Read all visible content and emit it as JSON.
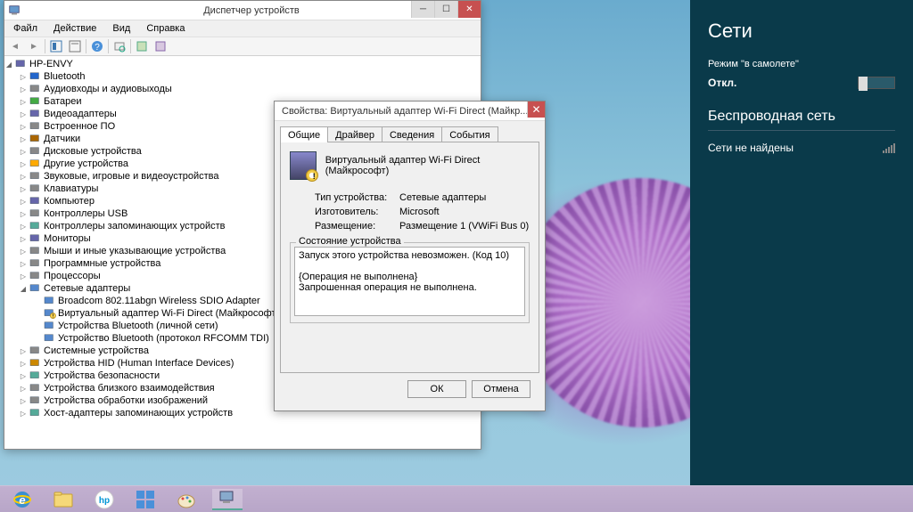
{
  "device_manager": {
    "title": "Диспетчер устройств",
    "menu": [
      "Файл",
      "Действие",
      "Вид",
      "Справка"
    ],
    "root": "HP-ENVY",
    "tree": [
      {
        "label": "Bluetooth",
        "icon": "bt",
        "expand": "▷"
      },
      {
        "label": "Аудиовходы и аудиовыходы",
        "icon": "audio",
        "expand": "▷"
      },
      {
        "label": "Батареи",
        "icon": "battery",
        "expand": "▷"
      },
      {
        "label": "Видеоадаптеры",
        "icon": "display",
        "expand": "▷"
      },
      {
        "label": "Встроенное ПО",
        "icon": "chip",
        "expand": "▷"
      },
      {
        "label": "Датчики",
        "icon": "sensor",
        "expand": "▷"
      },
      {
        "label": "Дисковые устройства",
        "icon": "disk",
        "expand": "▷"
      },
      {
        "label": "Другие устройства",
        "icon": "unknown",
        "expand": "▷"
      },
      {
        "label": "Звуковые, игровые и видеоустройства",
        "icon": "sound",
        "expand": "▷"
      },
      {
        "label": "Клавиатуры",
        "icon": "keyboard",
        "expand": "▷"
      },
      {
        "label": "Компьютер",
        "icon": "computer",
        "expand": "▷"
      },
      {
        "label": "Контроллеры USB",
        "icon": "usb",
        "expand": "▷"
      },
      {
        "label": "Контроллеры запоминающих устройств",
        "icon": "storage",
        "expand": "▷"
      },
      {
        "label": "Мониторы",
        "icon": "monitor",
        "expand": "▷"
      },
      {
        "label": "Мыши и иные указывающие устройства",
        "icon": "mouse",
        "expand": "▷"
      },
      {
        "label": "Программные устройства",
        "icon": "soft",
        "expand": "▷"
      },
      {
        "label": "Процессоры",
        "icon": "cpu",
        "expand": "▷"
      },
      {
        "label": "Сетевые адаптеры",
        "icon": "net",
        "expand": "◢",
        "expanded": true,
        "children": [
          {
            "label": "Broadcom 802.11abgn Wireless SDIO Adapter",
            "icon": "net"
          },
          {
            "label": "Виртуальный адаптер Wi-Fi Direct (Майкрософт)",
            "icon": "net-warn"
          },
          {
            "label": "Устройства Bluetooth (личной сети)",
            "icon": "net"
          },
          {
            "label": "Устройство Bluetooth (протокол RFCOMM TDI)",
            "icon": "net"
          }
        ]
      },
      {
        "label": "Системные устройства",
        "icon": "system",
        "expand": "▷"
      },
      {
        "label": "Устройства HID (Human Interface Devices)",
        "icon": "hid",
        "expand": "▷"
      },
      {
        "label": "Устройства безопасности",
        "icon": "security",
        "expand": "▷"
      },
      {
        "label": "Устройства близкого взаимодействия",
        "icon": "nfc",
        "expand": "▷"
      },
      {
        "label": "Устройства обработки изображений",
        "icon": "image",
        "expand": "▷"
      },
      {
        "label": "Хост-адаптеры запоминающих устройств",
        "icon": "host",
        "expand": "▷"
      }
    ]
  },
  "properties_dialog": {
    "title": "Свойства: Виртуальный адаптер Wi-Fi Direct (Майкр...",
    "tabs": [
      "Общие",
      "Драйвер",
      "Сведения",
      "События"
    ],
    "active_tab": 0,
    "device_name": "Виртуальный адаптер Wi-Fi Direct (Майкрософт)",
    "rows": {
      "type_label": "Тип устройства:",
      "type_value": "Сетевые адаптеры",
      "mfr_label": "Изготовитель:",
      "mfr_value": "Microsoft",
      "loc_label": "Размещение:",
      "loc_value": "Размещение 1 (VWiFi Bus 0)"
    },
    "status_group": "Состояние устройства",
    "status_text": "Запуск этого устройства невозможен. (Код 10)\n\n{Операция не выполнена}\nЗапрошенная операция не выполнена.",
    "ok": "ОК",
    "cancel": "Отмена"
  },
  "charm": {
    "title": "Сети",
    "airplane_label": "Режим \"в самолете\"",
    "airplane_state": "Откл.",
    "wifi_heading": "Беспроводная сеть",
    "no_networks": "Сети не найдены"
  }
}
